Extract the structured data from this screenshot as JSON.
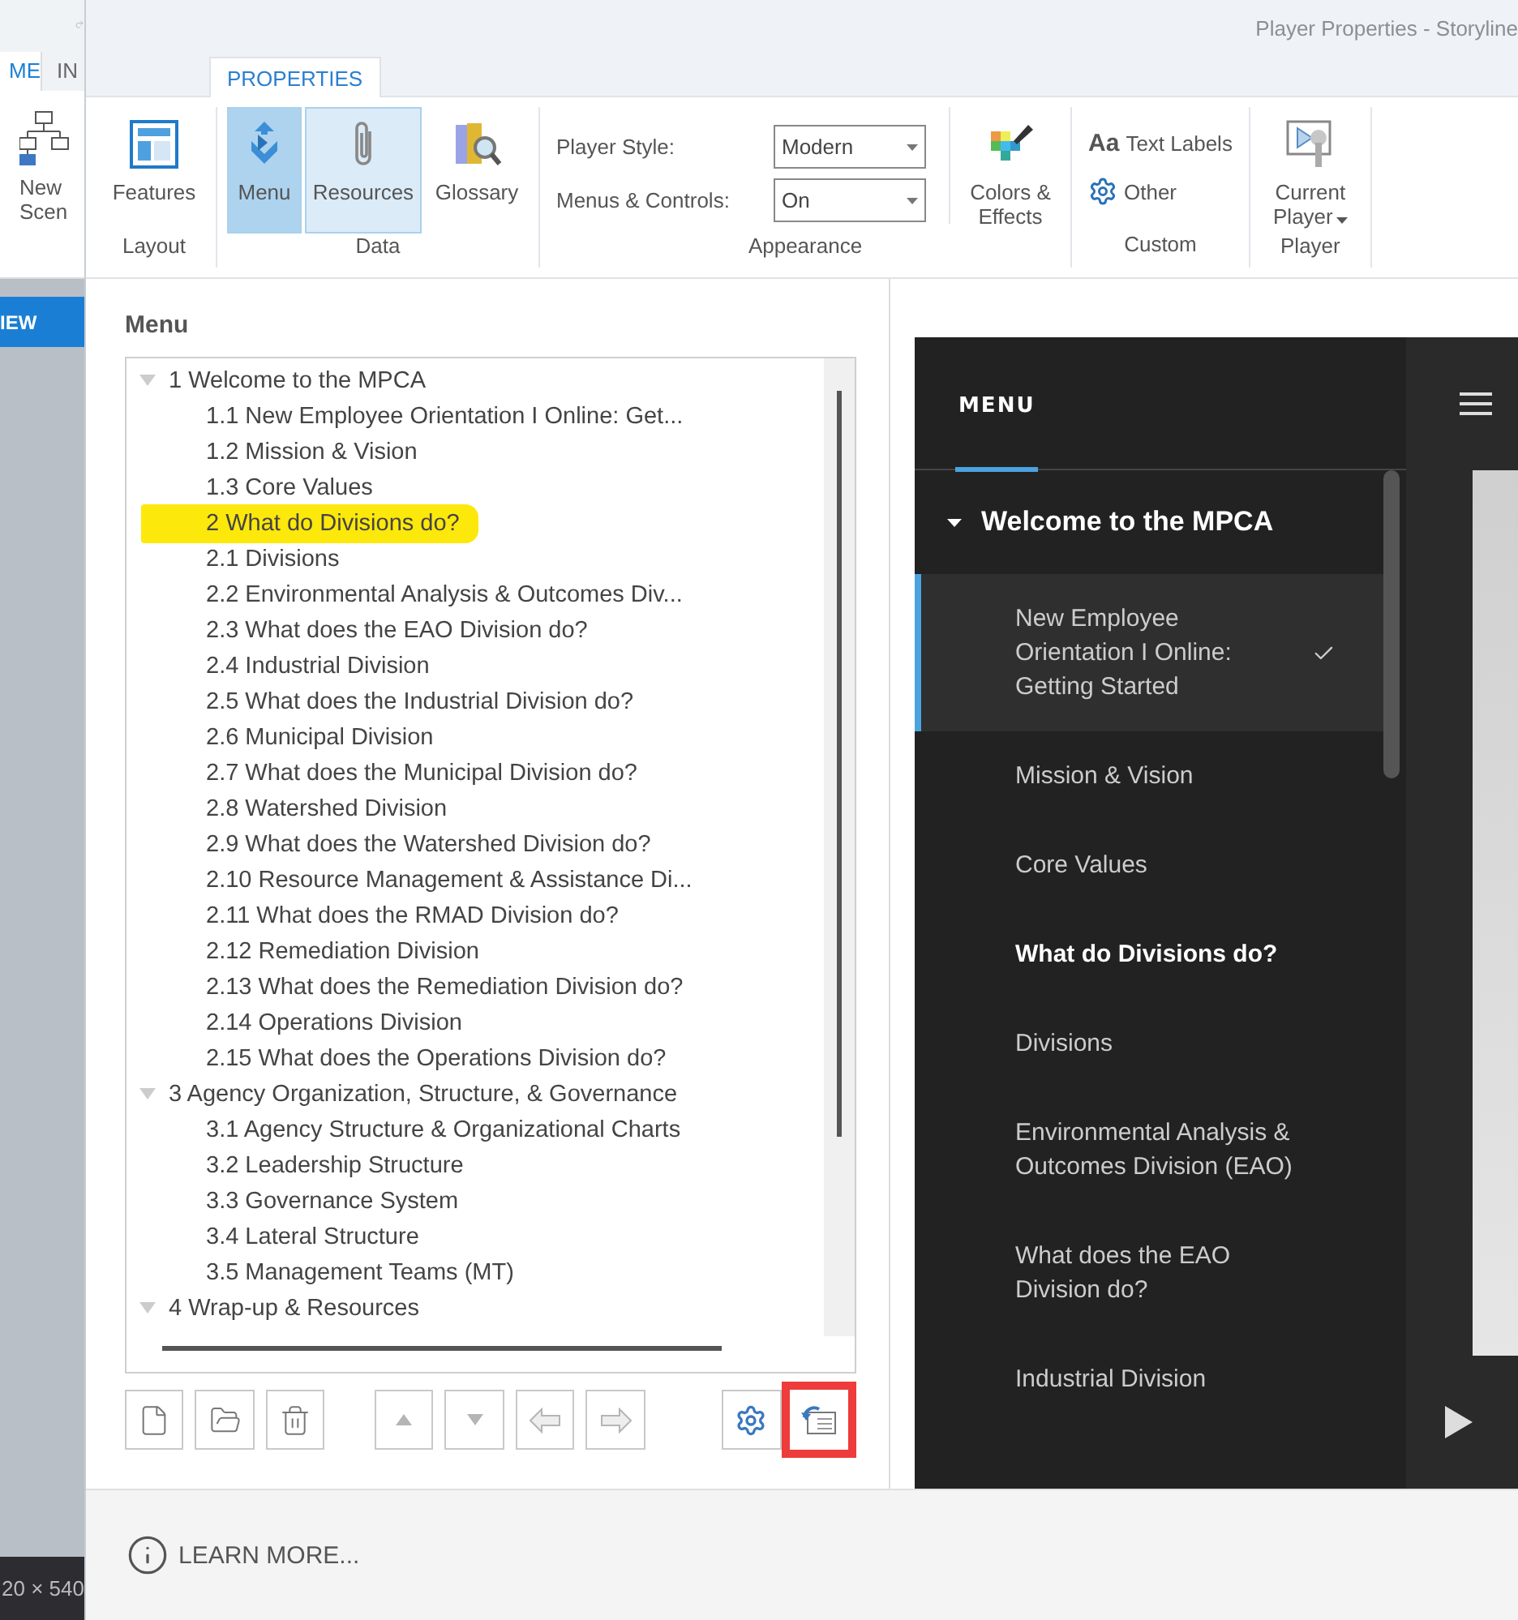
{
  "background_app": {
    "tabs": [
      {
        "label": "ME",
        "selected": true
      },
      {
        "label": "IN",
        "selected": false
      }
    ],
    "ribbon_button": "New Scen",
    "view_tab": "IEW",
    "status": "20 × 540"
  },
  "window": {
    "title": "Player Properties - Storyline"
  },
  "ribbon_tabs": [
    {
      "label": "PROPERTIES",
      "selected": true
    }
  ],
  "ribbon_groups": [
    {
      "label": "Layout",
      "items": [
        {
          "kind": "large",
          "label": "Features",
          "selected": false,
          "hovered": false
        }
      ]
    },
    {
      "label": "Data",
      "items": [
        {
          "kind": "large",
          "label": "Menu",
          "selected": true,
          "hovered": false
        },
        {
          "kind": "large",
          "label": "Resources",
          "selected": false,
          "hovered": true
        },
        {
          "kind": "large",
          "label": "Glossary",
          "selected": false,
          "hovered": false
        }
      ]
    },
    {
      "label": "Appearance",
      "items": [
        {
          "kind": "fields",
          "fields": [
            {
              "label": "Player Style:",
              "value": "Modern"
            },
            {
              "label": "Menus & Controls:",
              "value": "On"
            }
          ]
        },
        {
          "kind": "large",
          "label": "Colors & Effects",
          "selected": false,
          "hovered": false
        }
      ]
    },
    {
      "label": "Custom",
      "items": [
        {
          "kind": "small",
          "prefix": "Aa",
          "label": "Text Labels"
        },
        {
          "kind": "small",
          "label": "Other"
        }
      ]
    },
    {
      "label": "Player",
      "items": [
        {
          "kind": "dropdown",
          "label": "Current Player"
        }
      ]
    }
  ],
  "menu_editor": {
    "heading": "Menu",
    "tree": [
      {
        "label": "1 Welcome to the MPCA",
        "expanded": true,
        "children": [
          {
            "label": "1.1 New Employee Orientation I Online: Get...",
            "highlighted": false
          },
          {
            "label": "1.2 Mission & Vision",
            "highlighted": false
          },
          {
            "label": "1.3 Core Values",
            "highlighted": false
          },
          {
            "label": "2 What do Divisions do?",
            "highlighted": true
          },
          {
            "label": "2.1 Divisions",
            "highlighted": false
          },
          {
            "label": "2.2 Environmental Analysis & Outcomes Div...",
            "highlighted": false
          },
          {
            "label": "2.3 What does the EAO Division do?",
            "highlighted": false
          },
          {
            "label": "2.4 Industrial Division",
            "highlighted": false
          },
          {
            "label": "2.5 What does the Industrial Division do?",
            "highlighted": false
          },
          {
            "label": "2.6 Municipal Division",
            "highlighted": false
          },
          {
            "label": "2.7 What does the Municipal Division do?",
            "highlighted": false
          },
          {
            "label": "2.8 Watershed Division",
            "highlighted": false
          },
          {
            "label": "2.9 What does the Watershed Division do?",
            "highlighted": false
          },
          {
            "label": "2.10 Resource Management & Assistance Di...",
            "highlighted": false
          },
          {
            "label": "2.11 What does the RMAD Division do?",
            "highlighted": false
          },
          {
            "label": "2.12 Remediation Division",
            "highlighted": false
          },
          {
            "label": "2.13 What does the Remediation Division do?",
            "highlighted": false
          },
          {
            "label": "2.14 Operations Division",
            "highlighted": false
          },
          {
            "label": "2.15 What does the Operations Division do?",
            "highlighted": false
          }
        ]
      },
      {
        "label": "3 Agency Organization, Structure, & Governance",
        "expanded": true,
        "children": [
          {
            "label": "3.1 Agency Structure & Organizational Charts",
            "highlighted": false
          },
          {
            "label": "3.2 Leadership Structure",
            "highlighted": false
          },
          {
            "label": "3.3 Governance System",
            "highlighted": false
          },
          {
            "label": "3.4 Lateral Structure",
            "highlighted": false
          },
          {
            "label": "3.5 Management Teams (MT)",
            "highlighted": false
          }
        ]
      },
      {
        "label": "4 Wrap-up & Resources",
        "expanded": true
      }
    ],
    "toolbar": [
      {
        "disabled": false,
        "outlined": false
      },
      {
        "disabled": false,
        "outlined": false
      },
      {
        "disabled": false,
        "outlined": false
      },
      {
        "disabled": true,
        "outlined": false
      },
      {
        "disabled": true,
        "outlined": false
      },
      {
        "disabled": true,
        "outlined": false
      },
      {
        "disabled": true,
        "outlined": false
      },
      {
        "disabled": false,
        "outlined": false
      },
      {
        "disabled": false,
        "outlined": true
      }
    ]
  },
  "preview": {
    "title": "MENU",
    "section": {
      "label": "Welcome to the MPCA",
      "expanded": true
    },
    "items": [
      {
        "kind": "slide",
        "label": "New Employee Orientation I Online: Getting Started",
        "selected": true,
        "visited": true
      },
      {
        "kind": "slide",
        "label": "Mission & Vision",
        "selected": false,
        "visited": false
      },
      {
        "kind": "slide",
        "label": "Core Values",
        "selected": false,
        "visited": false
      },
      {
        "kind": "scene",
        "label": "What do Divisions do?",
        "selected": false,
        "visited": false
      },
      {
        "kind": "slide",
        "label": "Divisions",
        "selected": false,
        "visited": false
      },
      {
        "kind": "slide",
        "label": "Environmental Analysis & Outcomes Division (EAO)",
        "selected": false,
        "visited": false
      },
      {
        "kind": "slide",
        "label": "What does the EAO Division do?",
        "selected": false,
        "visited": false
      },
      {
        "kind": "slide",
        "label": "Industrial Division",
        "selected": false,
        "visited": false
      }
    ]
  },
  "footer": {
    "link": "LEARN MORE..."
  }
}
